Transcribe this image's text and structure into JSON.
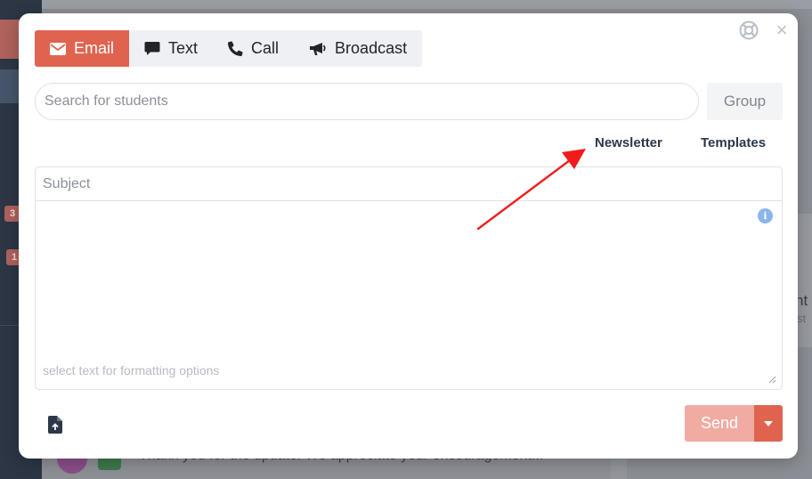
{
  "background": {
    "badges": [
      "3",
      "1"
    ],
    "partial_heading": "nt",
    "partial_sub": "st",
    "message_preview": "Thank you for the update. We appreciate your encouragement..."
  },
  "modal": {
    "tabs": [
      {
        "label": "Email",
        "icon": "envelope-icon",
        "active": true
      },
      {
        "label": "Text",
        "icon": "speech-bubble-icon",
        "active": false
      },
      {
        "label": "Call",
        "icon": "phone-icon",
        "active": false
      },
      {
        "label": "Broadcast",
        "icon": "megaphone-icon",
        "active": false
      }
    ],
    "search": {
      "placeholder": "Search for students",
      "value": ""
    },
    "group_label": "Group",
    "links": {
      "newsletter": "Newsletter",
      "templates": "Templates"
    },
    "subject": {
      "placeholder": "Subject",
      "value": ""
    },
    "info_glyph": "i",
    "hint": "select text for formatting options",
    "send_label": "Send",
    "close_glyph": "×"
  },
  "colors": {
    "accent": "#e0634f",
    "send_disabled": "#f0aba2",
    "annotation_arrow": "#f21b1b"
  }
}
